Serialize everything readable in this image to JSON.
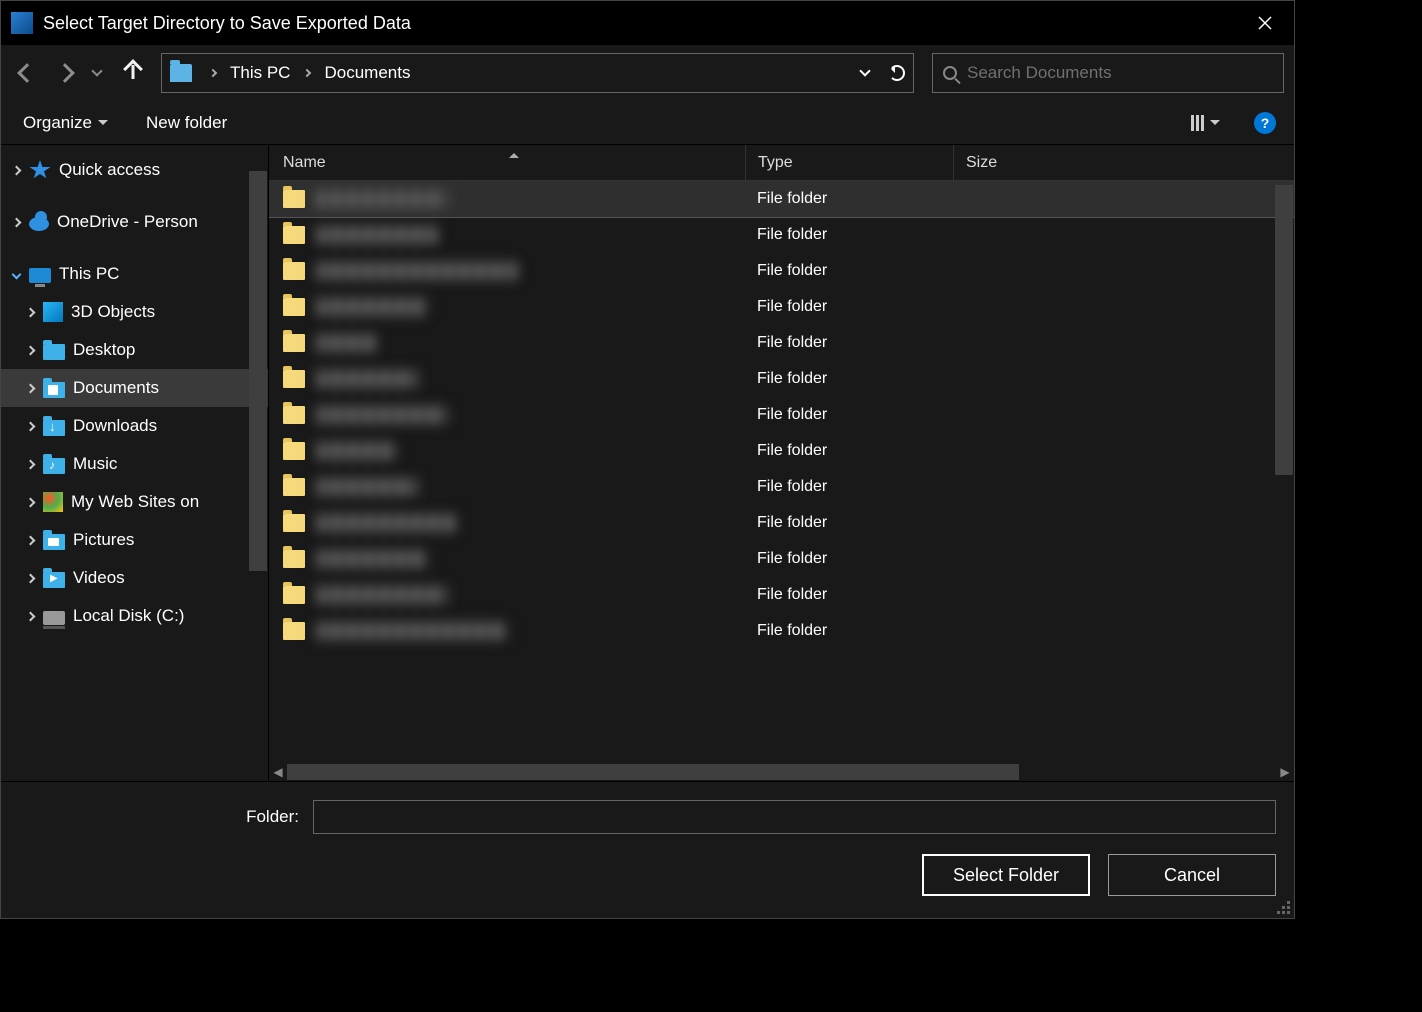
{
  "window": {
    "title": "Select Target Directory to Save Exported Data"
  },
  "breadcrumb": {
    "root": "This PC",
    "current": "Documents"
  },
  "search": {
    "placeholder": "Search Documents"
  },
  "toolbar": {
    "organize": "Organize",
    "newfolder": "New folder"
  },
  "sidebar": [
    {
      "label": "Quick access",
      "icon": "star",
      "depth": 0,
      "expandable": true,
      "open": false
    },
    {
      "label": "OneDrive - Person",
      "icon": "cloud",
      "depth": 0,
      "expandable": true,
      "open": false,
      "truncated": true
    },
    {
      "label": "This PC",
      "icon": "pc",
      "depth": 0,
      "expandable": true,
      "open": true
    },
    {
      "label": "3D Objects",
      "icon": "cube",
      "depth": 1,
      "expandable": true,
      "open": false
    },
    {
      "label": "Desktop",
      "icon": "folder",
      "depth": 1,
      "expandable": true,
      "open": false
    },
    {
      "label": "Documents",
      "icon": "folder-docs",
      "depth": 1,
      "expandable": true,
      "open": false,
      "selected": true
    },
    {
      "label": "Downloads",
      "icon": "folder-down",
      "depth": 1,
      "expandable": true,
      "open": false
    },
    {
      "label": "Music",
      "icon": "folder-music",
      "depth": 1,
      "expandable": true,
      "open": false
    },
    {
      "label": "My Web Sites on",
      "icon": "web",
      "depth": 1,
      "expandable": true,
      "open": false,
      "truncated": true
    },
    {
      "label": "Pictures",
      "icon": "folder-pic",
      "depth": 1,
      "expandable": true,
      "open": false
    },
    {
      "label": "Videos",
      "icon": "folder-vid",
      "depth": 1,
      "expandable": true,
      "open": false
    },
    {
      "label": "Local Disk (C:)",
      "icon": "disk",
      "depth": 1,
      "expandable": true,
      "open": false
    }
  ],
  "columns": {
    "name": "Name",
    "type": "Type",
    "size": "Size"
  },
  "files": [
    {
      "name_width": 130,
      "type": "File folder",
      "selected": true
    },
    {
      "name_width": 120,
      "type": "File folder"
    },
    {
      "name_width": 200,
      "type": "File folder"
    },
    {
      "name_width": 110,
      "type": "File folder"
    },
    {
      "name_width": 60,
      "type": "File folder"
    },
    {
      "name_width": 100,
      "type": "File folder"
    },
    {
      "name_width": 130,
      "type": "File folder"
    },
    {
      "name_width": 80,
      "type": "File folder"
    },
    {
      "name_width": 100,
      "type": "File folder"
    },
    {
      "name_width": 140,
      "type": "File folder"
    },
    {
      "name_width": 110,
      "type": "File folder"
    },
    {
      "name_width": 130,
      "type": "File folder"
    },
    {
      "name_width": 190,
      "type": "File folder"
    }
  ],
  "footer": {
    "folder_label": "Folder:",
    "folder_value": "",
    "select": "Select Folder",
    "cancel": "Cancel"
  }
}
